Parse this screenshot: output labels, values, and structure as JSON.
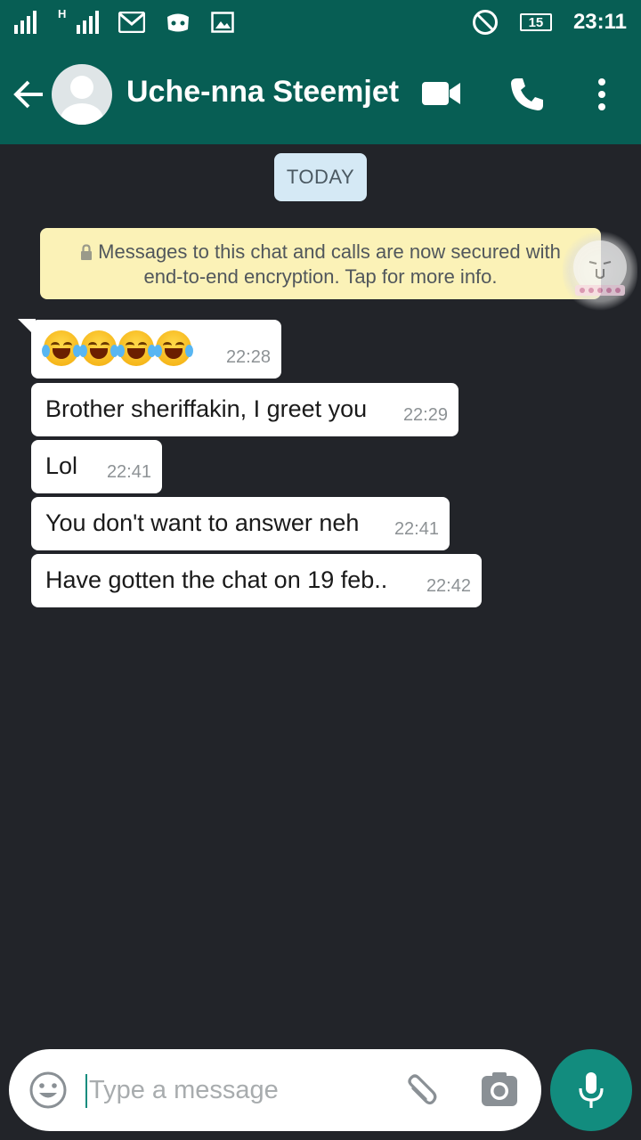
{
  "status_bar": {
    "net_label": "H",
    "time": "23:11",
    "battery": "15"
  },
  "header": {
    "contact_name": "Uche-nna Steemjet"
  },
  "chat": {
    "date_chip": "TODAY",
    "encryption_notice_line1": "Messages to this chat and calls are now secured with",
    "encryption_notice_line2": "end-to-end encryption. Tap for more info.",
    "messages": [
      {
        "text": "",
        "time": "22:28",
        "emoji_count": 4
      },
      {
        "text": "Brother sheriffakin, I greet you",
        "time": "22:29"
      },
      {
        "text": "Lol",
        "time": "22:41"
      },
      {
        "text": "You don't want to answer neh",
        "time": "22:41"
      },
      {
        "text": "Have gotten the chat on 19 feb..",
        "time": "22:42"
      }
    ]
  },
  "composer": {
    "placeholder": "Type a message"
  },
  "colors": {
    "header": "#075e54",
    "accent": "#128c7e",
    "chat_background": "#222429",
    "bubble": "#ffffff",
    "encryption_notice": "#fbf2b7",
    "date_chip": "#d5e9f5"
  },
  "icons": [
    "back-arrow-icon",
    "avatar-placeholder-icon",
    "video-call-icon",
    "voice-call-icon",
    "more-options-icon",
    "emoji-icon",
    "attach-icon",
    "camera-icon",
    "mic-icon",
    "lock-icon",
    "gmail-icon",
    "discord-icon",
    "gallery-icon",
    "dnd-icon"
  ]
}
